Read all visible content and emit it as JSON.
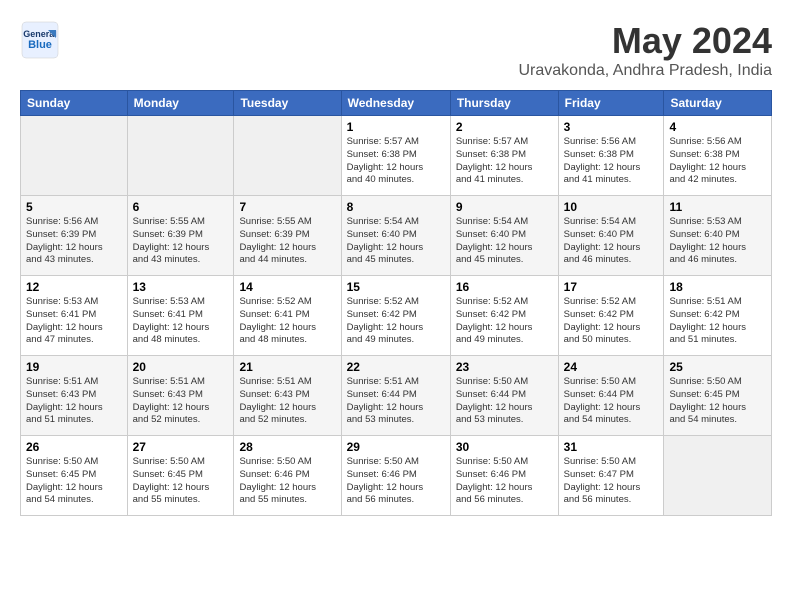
{
  "header": {
    "logo_general": "General",
    "logo_blue": "Blue",
    "month_title": "May 2024",
    "location": "Uravakonda, Andhra Pradesh, India"
  },
  "weekdays": [
    "Sunday",
    "Monday",
    "Tuesday",
    "Wednesday",
    "Thursday",
    "Friday",
    "Saturday"
  ],
  "weeks": [
    [
      {
        "day": "",
        "info": ""
      },
      {
        "day": "",
        "info": ""
      },
      {
        "day": "",
        "info": ""
      },
      {
        "day": "1",
        "info": "Sunrise: 5:57 AM\nSunset: 6:38 PM\nDaylight: 12 hours\nand 40 minutes."
      },
      {
        "day": "2",
        "info": "Sunrise: 5:57 AM\nSunset: 6:38 PM\nDaylight: 12 hours\nand 41 minutes."
      },
      {
        "day": "3",
        "info": "Sunrise: 5:56 AM\nSunset: 6:38 PM\nDaylight: 12 hours\nand 41 minutes."
      },
      {
        "day": "4",
        "info": "Sunrise: 5:56 AM\nSunset: 6:38 PM\nDaylight: 12 hours\nand 42 minutes."
      }
    ],
    [
      {
        "day": "5",
        "info": "Sunrise: 5:56 AM\nSunset: 6:39 PM\nDaylight: 12 hours\nand 43 minutes."
      },
      {
        "day": "6",
        "info": "Sunrise: 5:55 AM\nSunset: 6:39 PM\nDaylight: 12 hours\nand 43 minutes."
      },
      {
        "day": "7",
        "info": "Sunrise: 5:55 AM\nSunset: 6:39 PM\nDaylight: 12 hours\nand 44 minutes."
      },
      {
        "day": "8",
        "info": "Sunrise: 5:54 AM\nSunset: 6:40 PM\nDaylight: 12 hours\nand 45 minutes."
      },
      {
        "day": "9",
        "info": "Sunrise: 5:54 AM\nSunset: 6:40 PM\nDaylight: 12 hours\nand 45 minutes."
      },
      {
        "day": "10",
        "info": "Sunrise: 5:54 AM\nSunset: 6:40 PM\nDaylight: 12 hours\nand 46 minutes."
      },
      {
        "day": "11",
        "info": "Sunrise: 5:53 AM\nSunset: 6:40 PM\nDaylight: 12 hours\nand 46 minutes."
      }
    ],
    [
      {
        "day": "12",
        "info": "Sunrise: 5:53 AM\nSunset: 6:41 PM\nDaylight: 12 hours\nand 47 minutes."
      },
      {
        "day": "13",
        "info": "Sunrise: 5:53 AM\nSunset: 6:41 PM\nDaylight: 12 hours\nand 48 minutes."
      },
      {
        "day": "14",
        "info": "Sunrise: 5:52 AM\nSunset: 6:41 PM\nDaylight: 12 hours\nand 48 minutes."
      },
      {
        "day": "15",
        "info": "Sunrise: 5:52 AM\nSunset: 6:42 PM\nDaylight: 12 hours\nand 49 minutes."
      },
      {
        "day": "16",
        "info": "Sunrise: 5:52 AM\nSunset: 6:42 PM\nDaylight: 12 hours\nand 49 minutes."
      },
      {
        "day": "17",
        "info": "Sunrise: 5:52 AM\nSunset: 6:42 PM\nDaylight: 12 hours\nand 50 minutes."
      },
      {
        "day": "18",
        "info": "Sunrise: 5:51 AM\nSunset: 6:42 PM\nDaylight: 12 hours\nand 51 minutes."
      }
    ],
    [
      {
        "day": "19",
        "info": "Sunrise: 5:51 AM\nSunset: 6:43 PM\nDaylight: 12 hours\nand 51 minutes."
      },
      {
        "day": "20",
        "info": "Sunrise: 5:51 AM\nSunset: 6:43 PM\nDaylight: 12 hours\nand 52 minutes."
      },
      {
        "day": "21",
        "info": "Sunrise: 5:51 AM\nSunset: 6:43 PM\nDaylight: 12 hours\nand 52 minutes."
      },
      {
        "day": "22",
        "info": "Sunrise: 5:51 AM\nSunset: 6:44 PM\nDaylight: 12 hours\nand 53 minutes."
      },
      {
        "day": "23",
        "info": "Sunrise: 5:50 AM\nSunset: 6:44 PM\nDaylight: 12 hours\nand 53 minutes."
      },
      {
        "day": "24",
        "info": "Sunrise: 5:50 AM\nSunset: 6:44 PM\nDaylight: 12 hours\nand 54 minutes."
      },
      {
        "day": "25",
        "info": "Sunrise: 5:50 AM\nSunset: 6:45 PM\nDaylight: 12 hours\nand 54 minutes."
      }
    ],
    [
      {
        "day": "26",
        "info": "Sunrise: 5:50 AM\nSunset: 6:45 PM\nDaylight: 12 hours\nand 54 minutes."
      },
      {
        "day": "27",
        "info": "Sunrise: 5:50 AM\nSunset: 6:45 PM\nDaylight: 12 hours\nand 55 minutes."
      },
      {
        "day": "28",
        "info": "Sunrise: 5:50 AM\nSunset: 6:46 PM\nDaylight: 12 hours\nand 55 minutes."
      },
      {
        "day": "29",
        "info": "Sunrise: 5:50 AM\nSunset: 6:46 PM\nDaylight: 12 hours\nand 56 minutes."
      },
      {
        "day": "30",
        "info": "Sunrise: 5:50 AM\nSunset: 6:46 PM\nDaylight: 12 hours\nand 56 minutes."
      },
      {
        "day": "31",
        "info": "Sunrise: 5:50 AM\nSunset: 6:47 PM\nDaylight: 12 hours\nand 56 minutes."
      },
      {
        "day": "",
        "info": ""
      }
    ]
  ]
}
